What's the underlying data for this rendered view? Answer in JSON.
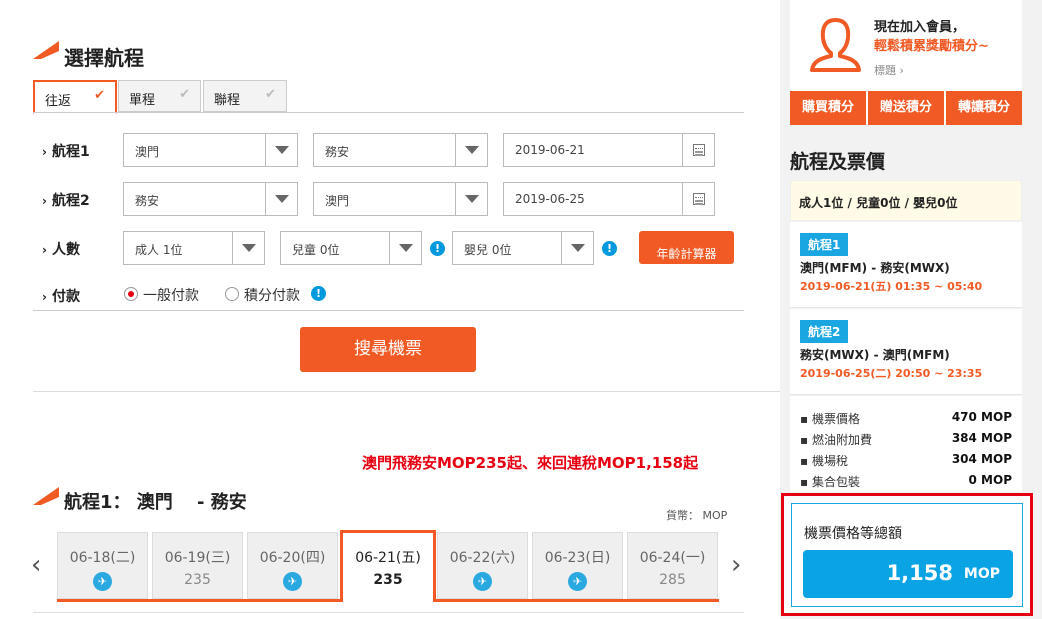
{
  "section": {
    "title": "選擇航程"
  },
  "tabs": [
    {
      "label": "往返",
      "active": true
    },
    {
      "label": "單程",
      "active": false
    },
    {
      "label": "聯程",
      "active": false
    }
  ],
  "rows": {
    "leg1": {
      "label": "航程1",
      "from": "澳門",
      "to": "務安",
      "date": "2019-06-21"
    },
    "leg2": {
      "label": "航程2",
      "from": "務安",
      "to": "澳門",
      "date": "2019-06-25"
    },
    "pax": {
      "label": "人數",
      "adult": "成人 1位",
      "child": "兒童 0位",
      "infant": "嬰兒 0位",
      "age_calc": "年齡計算器"
    },
    "payment": {
      "label": "付款",
      "opt1": "一般付款",
      "opt2": "積分付款"
    }
  },
  "search_label": "搜尋機票",
  "promo": "澳門飛務安MOP235起、來回連稅MOP1,158起",
  "results": {
    "title": "航程1： 澳門　 - 務安",
    "currency_label": "貨幣：",
    "currency": "MOP",
    "days": [
      {
        "date": "06-18(二)",
        "price": ""
      },
      {
        "date": "06-19(三)",
        "price": "235"
      },
      {
        "date": "06-20(四)",
        "price": ""
      },
      {
        "date": "06-21(五)",
        "price": "235"
      },
      {
        "date": "06-22(六)",
        "price": ""
      },
      {
        "date": "06-23(日)",
        "price": ""
      },
      {
        "date": "06-24(一)",
        "price": "285"
      }
    ]
  },
  "member": {
    "line1": "現在加入會員，",
    "line2": "輕鬆積累獎勵積分~",
    "more": "標題",
    "tabs": [
      "購買積分",
      "贈送積分",
      "轉讓積分"
    ]
  },
  "summary": {
    "title": "航程及票價",
    "pax": "成人1位 / 兒童0位 / 嬰兒0位",
    "flights": [
      {
        "badge": "航程1",
        "route": "澳門(MFM) - 務安(MWX)",
        "time": "2019-06-21(五) 01:35 ~ 05:40"
      },
      {
        "badge": "航程2",
        "route": "務安(MWX) - 澳門(MFM)",
        "time": "2019-06-25(二) 20:50 ~ 23:35"
      }
    ],
    "prices": [
      {
        "label": "機票價格",
        "amount": "470 MOP"
      },
      {
        "label": "燃油附加費",
        "amount": "384 MOP"
      },
      {
        "label": "機場稅",
        "amount": "304 MOP"
      },
      {
        "label": "集合包裝",
        "amount": "0 MOP"
      }
    ],
    "total_label": "機票價格等總額",
    "total": "1,158",
    "total_currency": "MOP"
  },
  "colors": {
    "accent": "#f15a24",
    "blue": "#0099dd",
    "highlight": "#e60012"
  }
}
